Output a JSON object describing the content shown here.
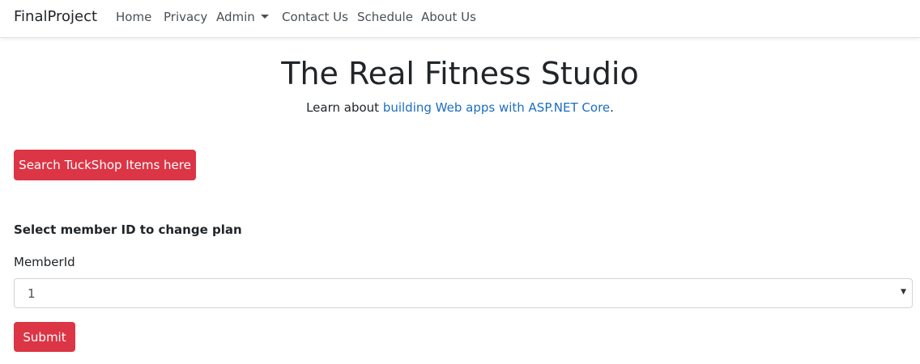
{
  "navbar": {
    "brand": "FinalProject",
    "links": [
      "Home",
      "Privacy",
      "Admin",
      "Contact Us",
      "Schedule",
      "About Us"
    ]
  },
  "hero": {
    "title": "The Real Fitness Studio",
    "lead_prefix": "Learn about ",
    "lead_link": "building Web apps with ASP.NET Core",
    "lead_suffix": "."
  },
  "search_button": "Search TuckShop Items here",
  "form": {
    "heading": "Select member ID to change plan",
    "label": "MemberId",
    "selected_value": "1",
    "submit_label": "Submit"
  },
  "colors": {
    "accent_red": "#dc3545",
    "link_blue": "#1b6ec2"
  }
}
